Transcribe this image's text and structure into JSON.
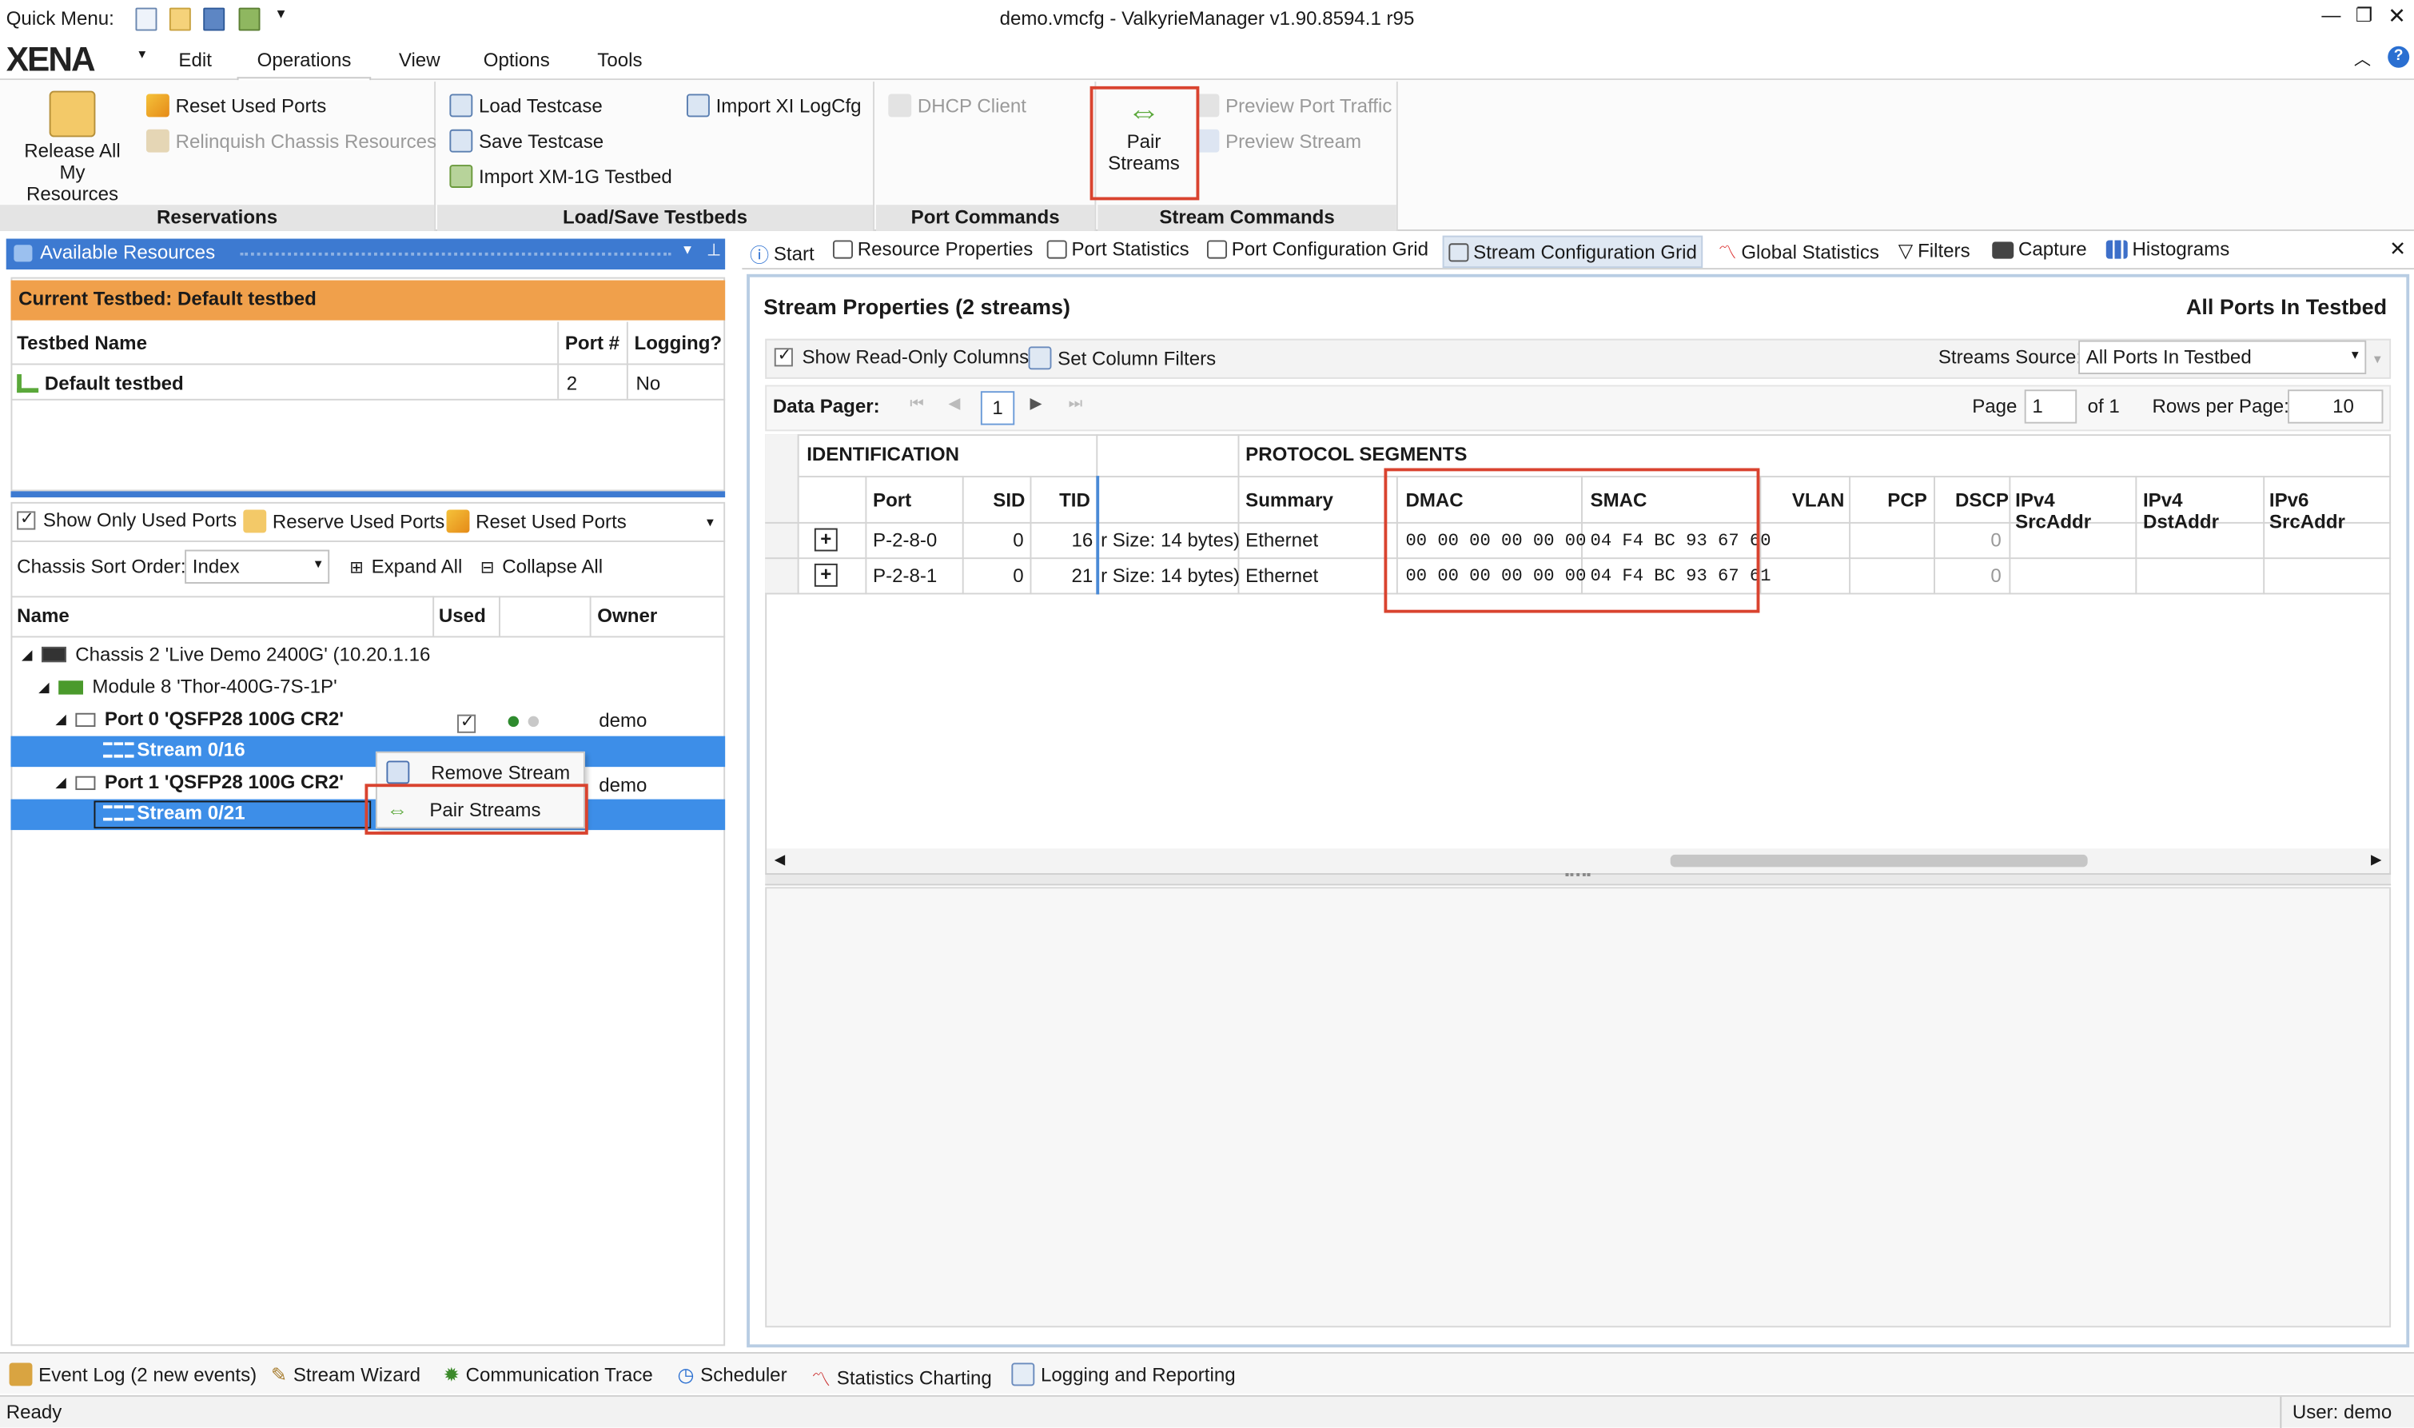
{
  "titlebar": {
    "quick_menu": "Quick Menu:",
    "title": "demo.vmcfg - ValkyrieManager v1.90.8594.1 r95"
  },
  "menu": {
    "logo": "XENA",
    "items": [
      "Edit",
      "Operations",
      "View",
      "Options",
      "Tools"
    ]
  },
  "ribbon": {
    "reservations": {
      "release_all": "Release All\nMy Resources",
      "reset_used": "Reset Used Ports",
      "relinquish": "Relinquish Chassis Resources",
      "title": "Reservations"
    },
    "load_save": {
      "load": "Load Testcase",
      "save": "Save Testcase",
      "import_xm": "Import XM-1G Testbed",
      "import_xi": "Import XI LogCfg",
      "title": "Load/Save Testbeds"
    },
    "port_commands": {
      "dhcp": "DHCP Client",
      "title": "Port Commands"
    },
    "stream_commands": {
      "pair": "Pair\nStreams",
      "preview_port": "Preview Port Traffic",
      "preview_stream": "Preview Stream",
      "title": "Stream Commands"
    }
  },
  "left": {
    "header": "Available Resources",
    "current_testbed": "Current Testbed:  Default testbed",
    "testbed_table": {
      "cols": [
        "Testbed Name",
        "Port #",
        "Logging?"
      ],
      "row": [
        "Default testbed",
        "2",
        "No"
      ]
    },
    "toolbar": {
      "show_only": "Show Only Used Ports",
      "reserve": "Reserve Used Ports",
      "reset": "Reset Used Ports"
    },
    "sort_label": "Chassis Sort Order:",
    "sort_value": "Index",
    "expand": "Expand All",
    "collapse": "Collapse All",
    "tree_cols": [
      "Name",
      "Used",
      "Owner"
    ],
    "tree": {
      "chassis": "Chassis 2 'Live Demo 2400G' (10.20.1.16",
      "module": "Module 8 'Thor-400G-7S-1P'",
      "port0": "Port 0 'QSFP28 100G CR2'",
      "port0_owner": "demo",
      "stream0": "Stream 0/16",
      "port1": "Port 1 'QSFP28 100G CR2'",
      "port1_owner": "demo",
      "stream1": "Stream 0/21"
    },
    "context_menu": [
      "Remove Stream",
      "Pair Streams"
    ]
  },
  "tabs": [
    "Start",
    "Resource Properties",
    "Port Statistics",
    "Port Configuration Grid",
    "Stream Configuration Grid",
    "Global Statistics",
    "Filters",
    "Capture",
    "Histograms"
  ],
  "stream": {
    "title": "Stream Properties (2 streams)",
    "scope": "All Ports In Testbed",
    "show_readonly": "Show Read-Only Columns",
    "set_filters": "Set Column Filters",
    "source_label": "Streams Source:",
    "source_value": "All Ports In Testbed",
    "pager_label": "Data Pager:",
    "pager_page": "1",
    "page_label": "Page",
    "page_value": "1",
    "of_label": "of 1",
    "rows_label": "Rows per Page:",
    "rows_value": "10",
    "group_ident": "IDENTIFICATION",
    "group_proto": "PROTOCOL SEGMENTS",
    "cols": [
      "Port",
      "SID",
      "TID",
      "",
      "Summary",
      "DMAC",
      "SMAC",
      "VLAN",
      "PCP",
      "DSCP",
      "IPv4 SrcAddr",
      "IPv4 DstAddr",
      "IPv6 SrcAddr"
    ],
    "rows": [
      {
        "port": "P-2-8-0",
        "sid": "0",
        "tid": "16",
        "size": "r Size: 14 bytes)",
        "summary": "Ethernet",
        "dmac": "00 00 00 00 00 00",
        "smac": "04 F4 BC 93 67 60",
        "dscp": "0"
      },
      {
        "port": "P-2-8-1",
        "sid": "0",
        "tid": "21",
        "size": "r Size: 14 bytes)",
        "summary": "Ethernet",
        "dmac": "00 00 00 00 00 00",
        "smac": "04 F4 BC 93 67 61",
        "dscp": "0"
      }
    ]
  },
  "bottom_tabs": [
    "Event Log (2 new events)",
    "Stream Wizard",
    "Communication Trace",
    "Scheduler",
    "Statistics Charting",
    "Logging and Reporting"
  ],
  "status": {
    "left": "Ready",
    "right": "User: demo"
  }
}
